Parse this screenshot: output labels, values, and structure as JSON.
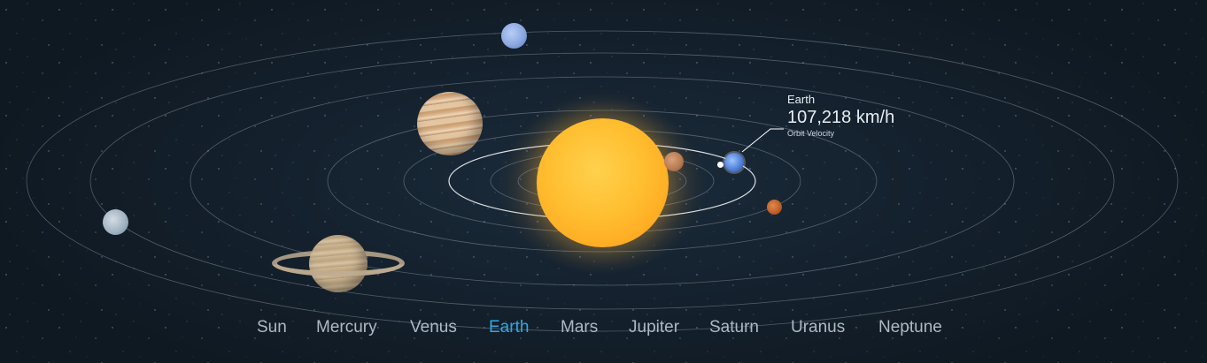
{
  "planets": {
    "sun": "sun-icon",
    "mercury": "mercury-icon",
    "venus": "venus-icon",
    "earth": "earth-icon",
    "moon": "moon-icon",
    "mars": "mars-icon",
    "jupiter": "jupiter-icon",
    "saturn": "saturn-icon",
    "uranus": "uranus-icon"
  },
  "callout": {
    "name": "Earth",
    "value": "107,218 km/h",
    "caption": "Orbit Velocity"
  },
  "nav": {
    "items": [
      {
        "label": "Sun"
      },
      {
        "label": "Mercury"
      },
      {
        "label": "Venus"
      },
      {
        "label": "Earth"
      },
      {
        "label": "Mars"
      },
      {
        "label": "Jupiter"
      },
      {
        "label": "Saturn"
      },
      {
        "label": "Uranus"
      },
      {
        "label": "Neptune"
      }
    ],
    "active": "Earth"
  },
  "colors": {
    "background": "#0f1a24",
    "active_nav": "#2fa9e6",
    "nav": "#aeb9c4",
    "orbit": "#c8d2dc"
  }
}
